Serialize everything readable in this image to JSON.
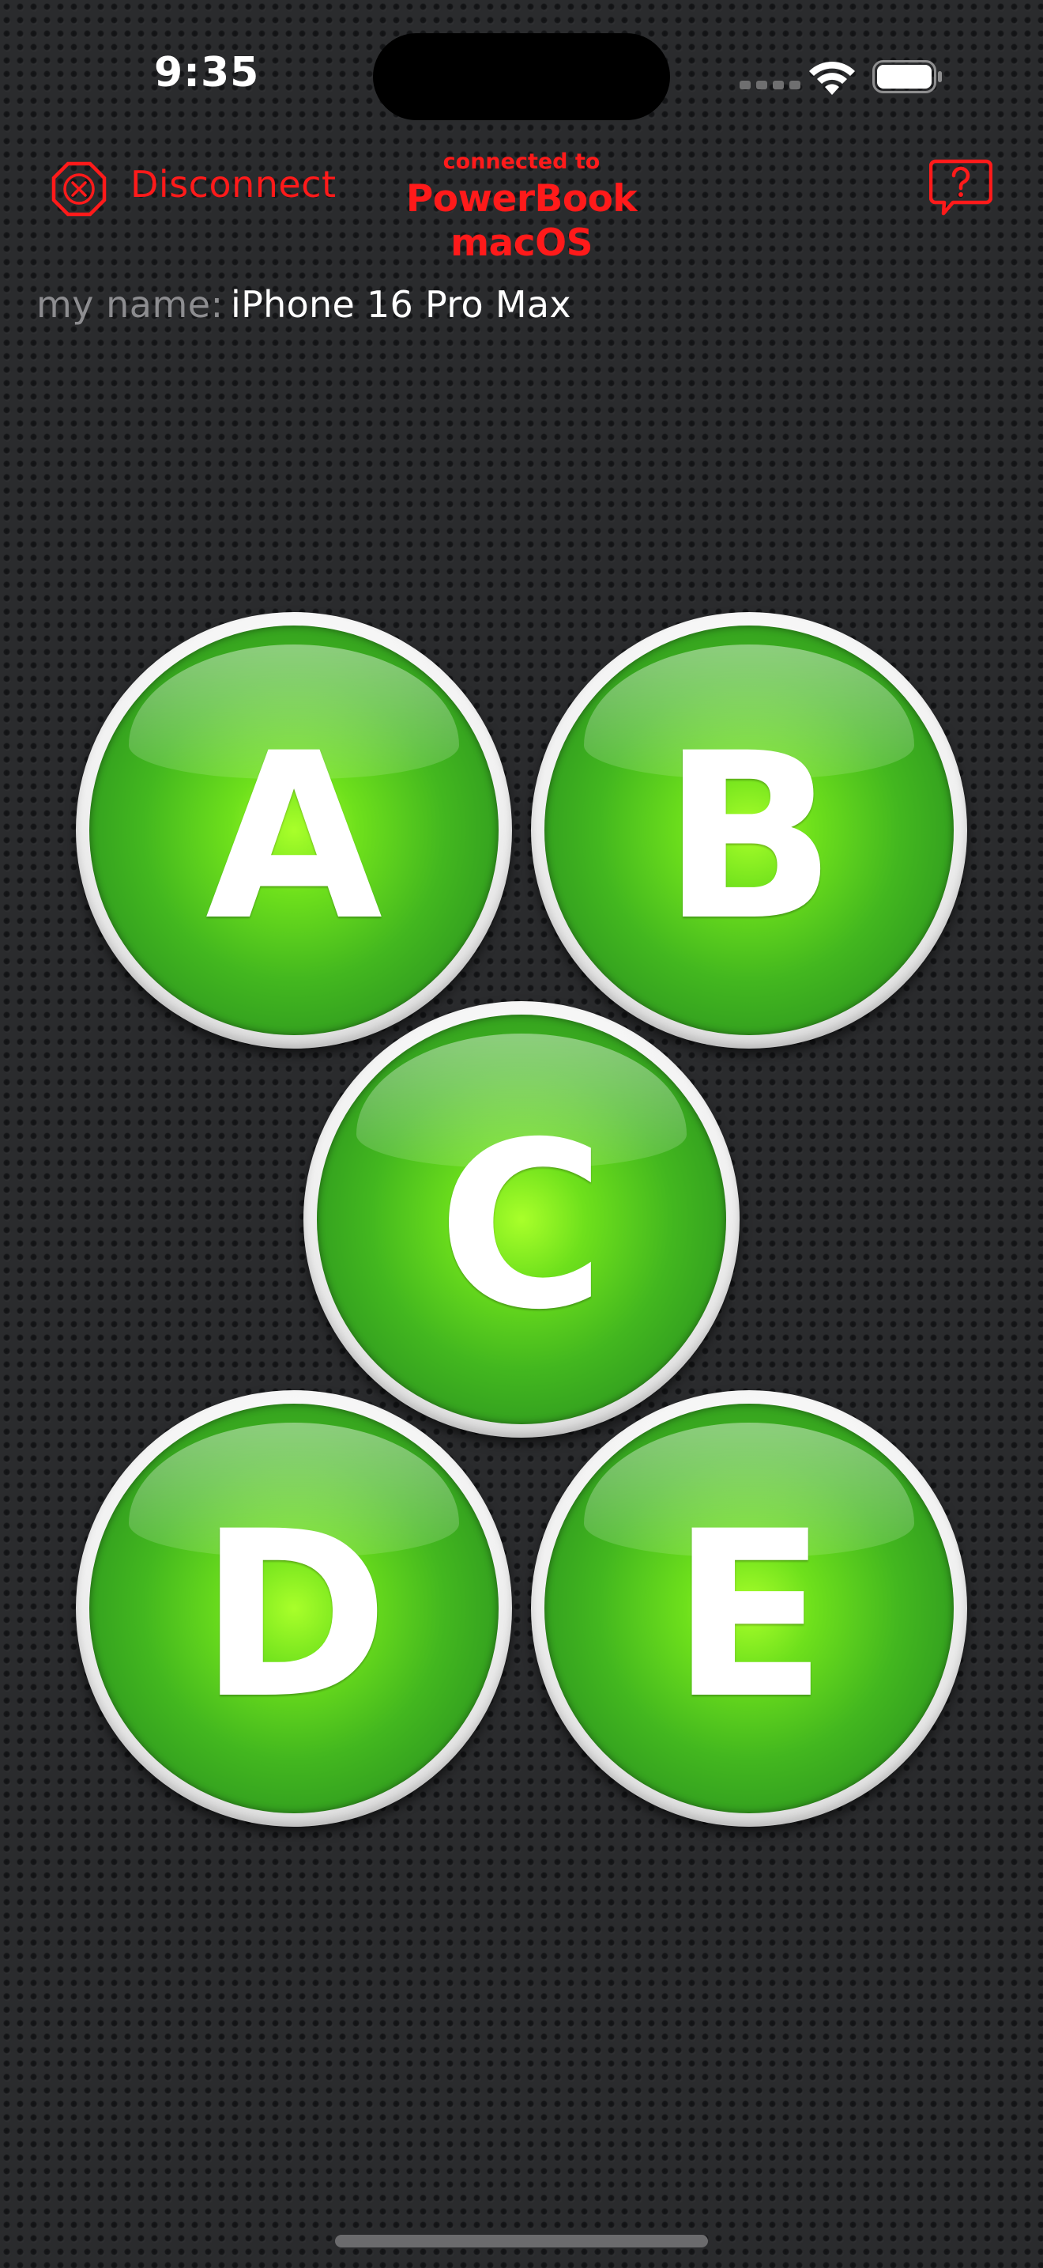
{
  "status_bar": {
    "time": "9:35"
  },
  "header": {
    "disconnect_label": "Disconnect",
    "connected_to_label": "connected to",
    "connected_device": "PowerBook macOS"
  },
  "my_name": {
    "label": "my name:",
    "value": "iPhone 16 Pro Max"
  },
  "buttons": [
    {
      "letter": "A"
    },
    {
      "letter": "B"
    },
    {
      "letter": "C"
    },
    {
      "letter": "D"
    },
    {
      "letter": "E"
    }
  ],
  "colors": {
    "accent_red": "#ff1a1a",
    "button_green": "#43b71f",
    "background": "#2a2b2d"
  },
  "icons": {
    "disconnect": "close-circle-icon",
    "help": "help-bubble-icon",
    "wifi": "wifi-icon",
    "battery": "battery-icon",
    "signal": "cellular-signal-icon"
  }
}
